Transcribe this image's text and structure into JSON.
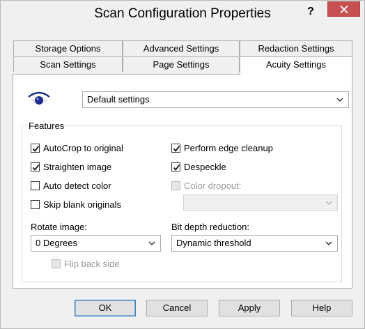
{
  "window": {
    "title": "Scan Configuration Properties",
    "help_label": "?",
    "close_icon": "close-icon",
    "colors": {
      "close": "#c75050",
      "accent": "#3c7fb1"
    }
  },
  "tabs": {
    "row1": [
      "Storage Options",
      "Advanced Settings",
      "Redaction Settings"
    ],
    "row2": [
      "Scan Settings",
      "Page Settings",
      "Acuity Settings"
    ],
    "active": "Acuity Settings"
  },
  "preset": {
    "icon": "eye-icon",
    "value": "Default settings"
  },
  "features": {
    "label": "Features",
    "autocrop": {
      "label": "AutoCrop to original",
      "checked": true
    },
    "straighten": {
      "label": "Straighten image",
      "checked": true
    },
    "auto_color": {
      "label": "Auto detect color",
      "checked": false
    },
    "skip_blank": {
      "label": "Skip blank originals",
      "checked": false
    },
    "edge_cleanup": {
      "label": "Perform edge cleanup",
      "checked": true
    },
    "despeckle": {
      "label": "Despeckle",
      "checked": true
    },
    "color_dropout": {
      "label": "Color dropout:",
      "checked": false,
      "disabled": true,
      "value": ""
    },
    "rotate": {
      "label": "Rotate image:",
      "value": "0 Degrees"
    },
    "flip_back": {
      "label": "Flip back side",
      "checked": false,
      "disabled": true
    },
    "bit_depth": {
      "label": "Bit depth reduction:",
      "value": "Dynamic threshold"
    }
  },
  "buttons": {
    "ok": "OK",
    "cancel": "Cancel",
    "apply": "Apply",
    "help": "Help"
  }
}
